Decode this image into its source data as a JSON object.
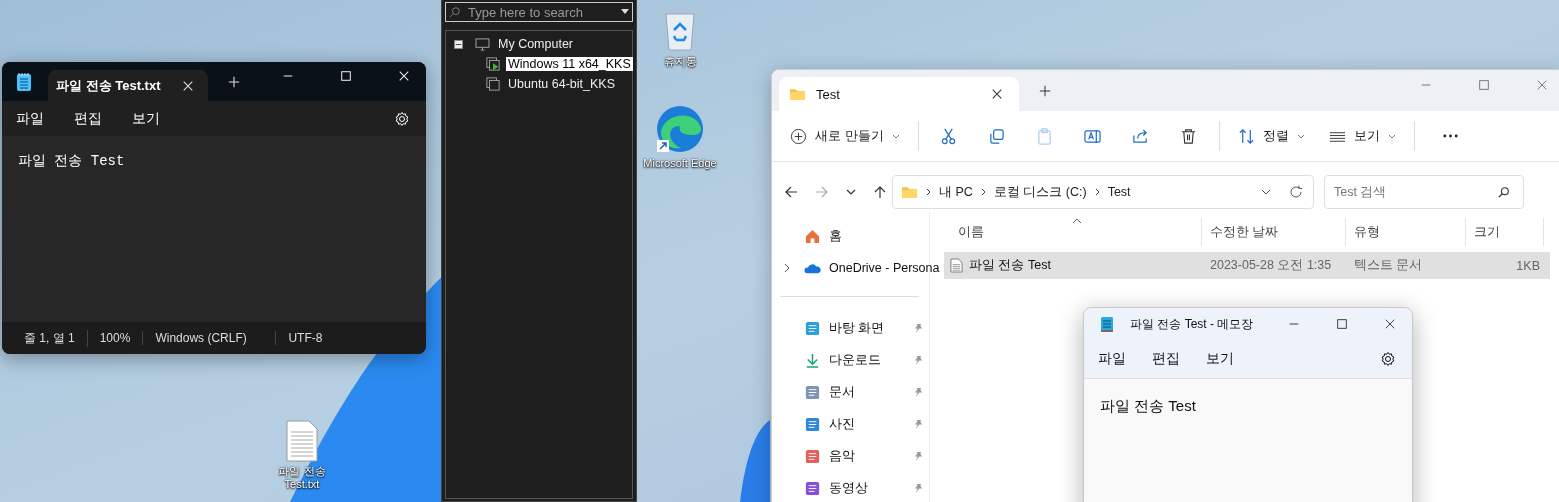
{
  "desktop_icons": [
    {
      "kind": "recycle",
      "label": "휴지통"
    },
    {
      "kind": "edge",
      "label": "Microsoft Edge"
    },
    {
      "kind": "textfile",
      "label": "파일 전송 Test.txt"
    }
  ],
  "notepad_dark": {
    "tabs": [
      {
        "label": "파일 전송 Test.txt",
        "selected": true
      }
    ],
    "menu": [
      "파일",
      "편집",
      "보기"
    ],
    "content": "파일 전송 Test",
    "status": [
      "줄 1, 열 1",
      "100%",
      "Windows (CRLF)",
      "UTF-8"
    ]
  },
  "vm_library": {
    "search": {
      "placeholder": "Type here to search"
    },
    "tree": [
      {
        "label": "My Computer",
        "expanded": true,
        "children": [
          {
            "label": "Windows 11 x64_KKS",
            "selected": true,
            "running": true
          },
          {
            "label": "Ubuntu 64-bit_KKS",
            "selected": false,
            "running": false
          }
        ]
      }
    ]
  },
  "explorer": {
    "tabs": [
      {
        "label": "Test",
        "selected": true
      }
    ],
    "toolbar": [
      {
        "kind": "new",
        "label": "새로 만들기",
        "disabled": false
      },
      {
        "kind": "cut",
        "disabled": false
      },
      {
        "kind": "copy",
        "disabled": false
      },
      {
        "kind": "paste",
        "disabled": true
      },
      {
        "kind": "rename",
        "disabled": false
      },
      {
        "kind": "share",
        "disabled": false
      },
      {
        "kind": "delete",
        "disabled": false
      },
      {
        "kind": "sort",
        "label": "정렬",
        "disabled": false
      },
      {
        "kind": "view",
        "label": "보기",
        "disabled": false
      },
      {
        "kind": "more",
        "disabled": false
      }
    ],
    "breadcrumb": [
      "내 PC",
      "로컬 디스크 (C:)",
      "Test"
    ],
    "search": {
      "placeholder": "Test 검색"
    },
    "nav": [
      {
        "kind": "home",
        "label": "홈",
        "pinned": false
      },
      {
        "kind": "onedrive",
        "label": "OneDrive - Persona",
        "pinned": false
      },
      {
        "kind": "divider"
      },
      {
        "kind": "desktop",
        "label": "바탕 화면",
        "pinned": true
      },
      {
        "kind": "download",
        "label": "다운로드",
        "pinned": true
      },
      {
        "kind": "documents",
        "label": "문서",
        "pinned": true
      },
      {
        "kind": "pictures",
        "label": "사진",
        "pinned": true
      },
      {
        "kind": "music",
        "label": "음악",
        "pinned": true
      },
      {
        "kind": "videos",
        "label": "동영상",
        "pinned": true
      }
    ],
    "columns": [
      "이름",
      "수정한 날짜",
      "유형",
      "크기"
    ],
    "rows": [
      {
        "name": "파일 전송 Test",
        "date": "2023-05-28 오전 1:35",
        "type": "텍스트 문서",
        "size": "1KB",
        "selected": true
      }
    ]
  },
  "notepad_light": {
    "title": "파일 전송 Test - 메모장",
    "menu": [
      "파일",
      "편집",
      "보기"
    ],
    "content": "파일 전송 Test"
  }
}
